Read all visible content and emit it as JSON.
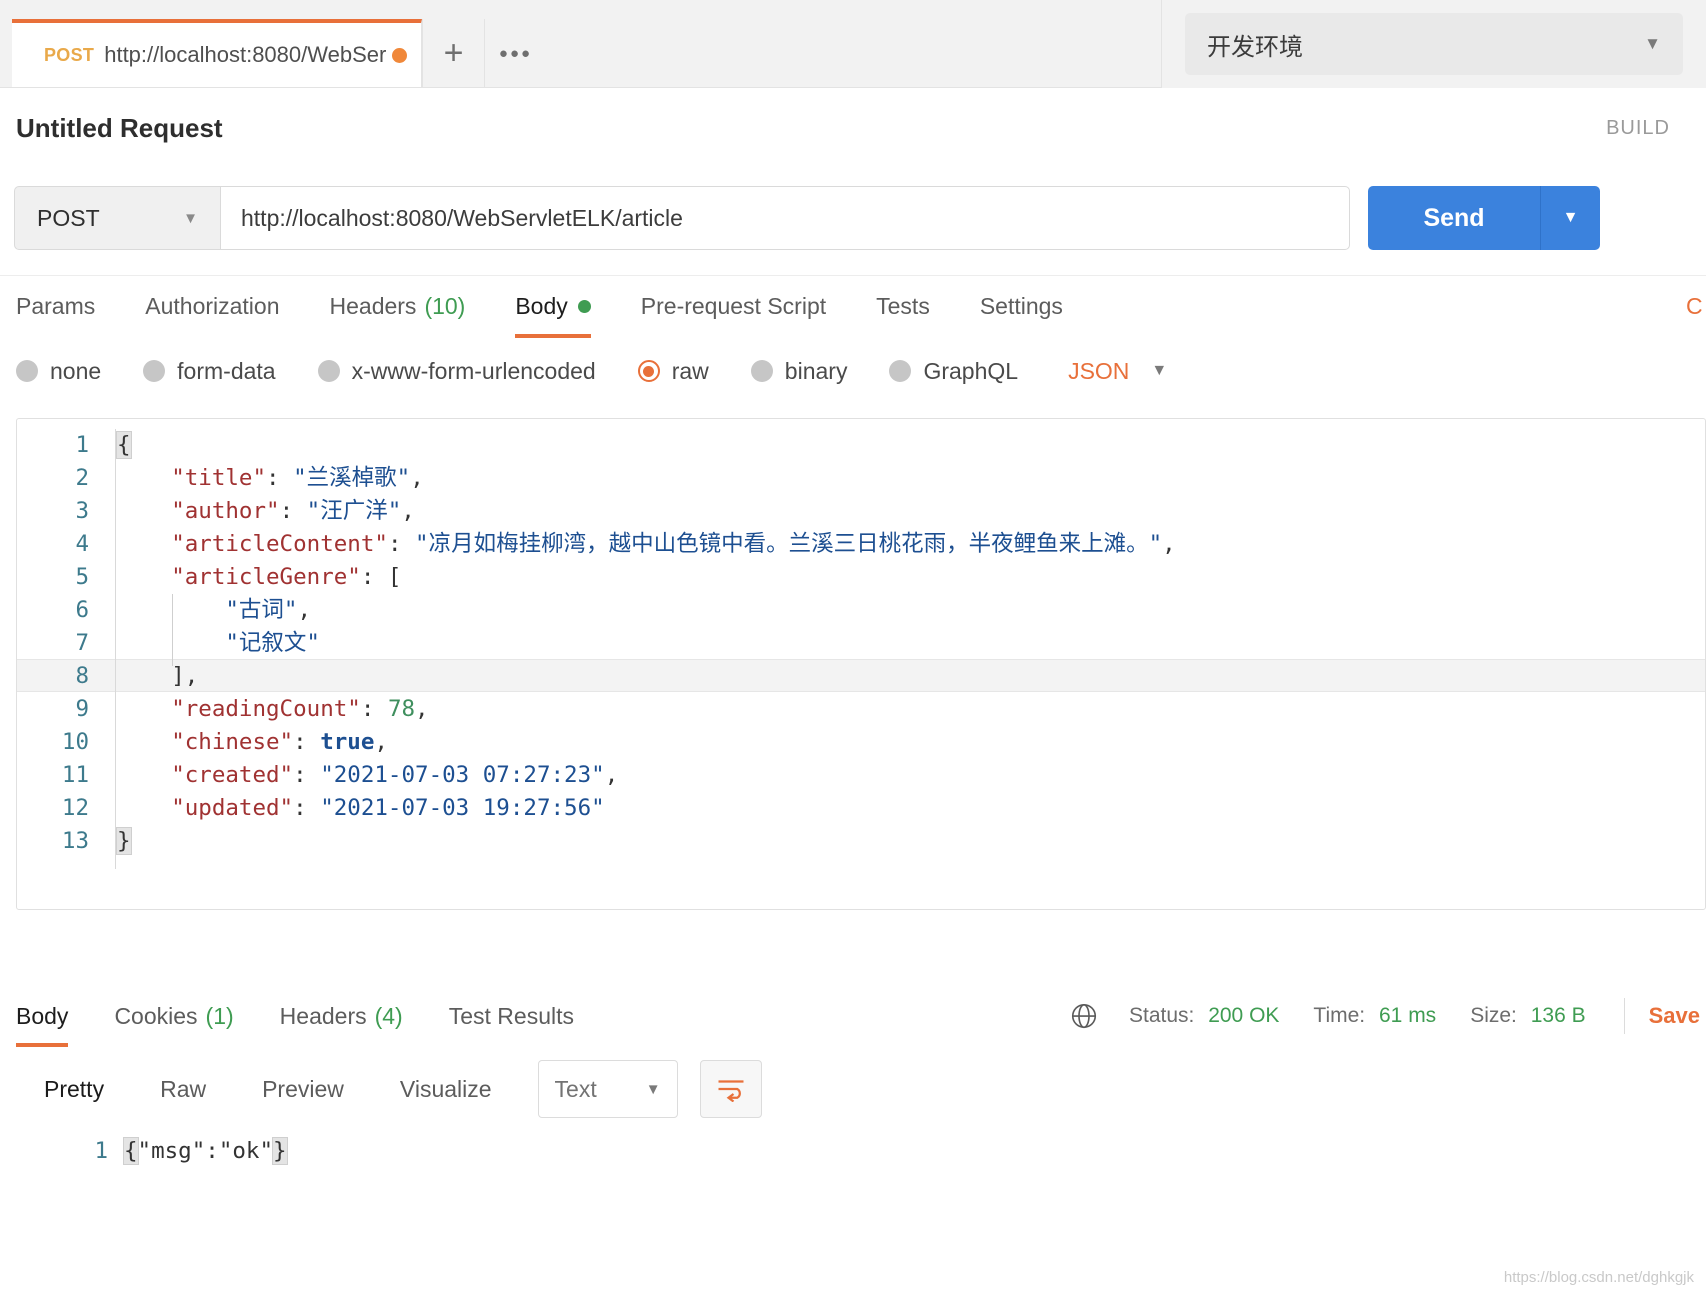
{
  "tabbar": {
    "request_tab": {
      "method": "POST",
      "url": "http://localhost:8080/WebServ...",
      "unsaved_dot": "●"
    },
    "new_tab_label": "+",
    "more_label": "●●●",
    "environment": {
      "name": "开发环境",
      "caret": "▼"
    }
  },
  "header": {
    "title": "Untitled Request",
    "build_label": "BUILD"
  },
  "url_bar": {
    "method": "POST",
    "method_caret": "▼",
    "url": "http://localhost:8080/WebServletELK/article",
    "send_label": "Send",
    "send_caret": "▼"
  },
  "request_tabs": [
    {
      "label": "Params",
      "count": "",
      "active": false,
      "dot": false
    },
    {
      "label": "Authorization",
      "count": "",
      "active": false,
      "dot": false
    },
    {
      "label": "Headers",
      "count": "(10)",
      "active": false,
      "dot": false
    },
    {
      "label": "Body",
      "count": "",
      "active": true,
      "dot": true
    },
    {
      "label": "Pre-request Script",
      "count": "",
      "active": false,
      "dot": false
    },
    {
      "label": "Tests",
      "count": "",
      "active": false,
      "dot": false
    },
    {
      "label": "Settings",
      "count": "",
      "active": false,
      "dot": false
    }
  ],
  "request_tabs_right": "C",
  "body_types": [
    {
      "label": "none",
      "selected": false
    },
    {
      "label": "form-data",
      "selected": false
    },
    {
      "label": "x-www-form-urlencoded",
      "selected": false
    },
    {
      "label": "raw",
      "selected": true
    },
    {
      "label": "binary",
      "selected": false
    },
    {
      "label": "GraphQL",
      "selected": false
    }
  ],
  "body_format": {
    "label": "JSON",
    "caret": "▼"
  },
  "request_body": {
    "line_numbers": [
      "1",
      "2",
      "3",
      "4",
      "5",
      "6",
      "7",
      "8",
      "9",
      "10",
      "11",
      "12",
      "13"
    ],
    "lines": [
      {
        "indent": 0,
        "tokens": [
          {
            "t": "{",
            "c": "p"
          }
        ]
      },
      {
        "indent": 1,
        "tokens": [
          {
            "t": "\"title\"",
            "c": "k"
          },
          {
            "t": ": ",
            "c": "p"
          },
          {
            "t": "\"兰溪棹歌\"",
            "c": "s"
          },
          {
            "t": ",",
            "c": "p"
          }
        ]
      },
      {
        "indent": 1,
        "tokens": [
          {
            "t": "\"author\"",
            "c": "k"
          },
          {
            "t": ": ",
            "c": "p"
          },
          {
            "t": "\"汪广洋\"",
            "c": "s"
          },
          {
            "t": ",",
            "c": "p"
          }
        ]
      },
      {
        "indent": 1,
        "tokens": [
          {
            "t": "\"articleContent\"",
            "c": "k"
          },
          {
            "t": ": ",
            "c": "p"
          },
          {
            "t": "\"凉月如梅挂柳湾，越中山色镜中看。兰溪三日桃花雨，半夜鲤鱼来上滩。\"",
            "c": "s"
          },
          {
            "t": ",",
            "c": "p"
          }
        ]
      },
      {
        "indent": 1,
        "tokens": [
          {
            "t": "\"articleGenre\"",
            "c": "k"
          },
          {
            "t": ": [",
            "c": "p"
          }
        ]
      },
      {
        "indent": 2,
        "tokens": [
          {
            "t": "\"古词\"",
            "c": "s"
          },
          {
            "t": ",",
            "c": "p"
          }
        ]
      },
      {
        "indent": 2,
        "tokens": [
          {
            "t": "\"记叙文\"",
            "c": "s"
          }
        ]
      },
      {
        "indent": 1,
        "tokens": [
          {
            "t": "],",
            "c": "p"
          }
        ]
      },
      {
        "indent": 1,
        "tokens": [
          {
            "t": "\"readingCount\"",
            "c": "k"
          },
          {
            "t": ": ",
            "c": "p"
          },
          {
            "t": "78",
            "c": "n"
          },
          {
            "t": ",",
            "c": "p"
          }
        ]
      },
      {
        "indent": 1,
        "tokens": [
          {
            "t": "\"chinese\"",
            "c": "k"
          },
          {
            "t": ": ",
            "c": "p"
          },
          {
            "t": "true",
            "c": "b"
          },
          {
            "t": ",",
            "c": "p"
          }
        ]
      },
      {
        "indent": 1,
        "tokens": [
          {
            "t": "\"created\"",
            "c": "k"
          },
          {
            "t": ": ",
            "c": "p"
          },
          {
            "t": "\"2021-07-03 07:27:23\"",
            "c": "s"
          },
          {
            "t": ",",
            "c": "p"
          }
        ]
      },
      {
        "indent": 1,
        "tokens": [
          {
            "t": "\"updated\"",
            "c": "k"
          },
          {
            "t": ": ",
            "c": "p"
          },
          {
            "t": "\"2021-07-03 19:27:56\"",
            "c": "s"
          }
        ]
      },
      {
        "indent": 0,
        "tokens": [
          {
            "t": "}",
            "c": "p"
          }
        ]
      }
    ],
    "highlighted_line": 8
  },
  "response_tabs": [
    {
      "label": "Body",
      "count": "",
      "active": true
    },
    {
      "label": "Cookies",
      "count": "(1)",
      "active": false
    },
    {
      "label": "Headers",
      "count": "(4)",
      "active": false
    },
    {
      "label": "Test Results",
      "count": "",
      "active": false
    }
  ],
  "response_meta": {
    "status_label": "Status:",
    "status_value": "200 OK",
    "time_label": "Time:",
    "time_value": "61 ms",
    "size_label": "Size:",
    "size_value": "136 B",
    "save_label": "Save"
  },
  "view_bar": {
    "views": [
      {
        "label": "Pretty",
        "active": true
      },
      {
        "label": "Raw",
        "active": false
      },
      {
        "label": "Preview",
        "active": false
      },
      {
        "label": "Visualize",
        "active": false
      }
    ],
    "format": {
      "label": "Text",
      "caret": "▼"
    }
  },
  "response_body": {
    "line_number": "1",
    "text": "{\"msg\":\"ok\"}"
  },
  "watermark": "https://blog.csdn.net/dghkgjk",
  "colors": {
    "accent_orange": "#e8703a",
    "send_blue": "#3b82dd",
    "success_green": "#3f9c52",
    "key_red": "#a03232",
    "string_blue": "#1d4f91"
  }
}
